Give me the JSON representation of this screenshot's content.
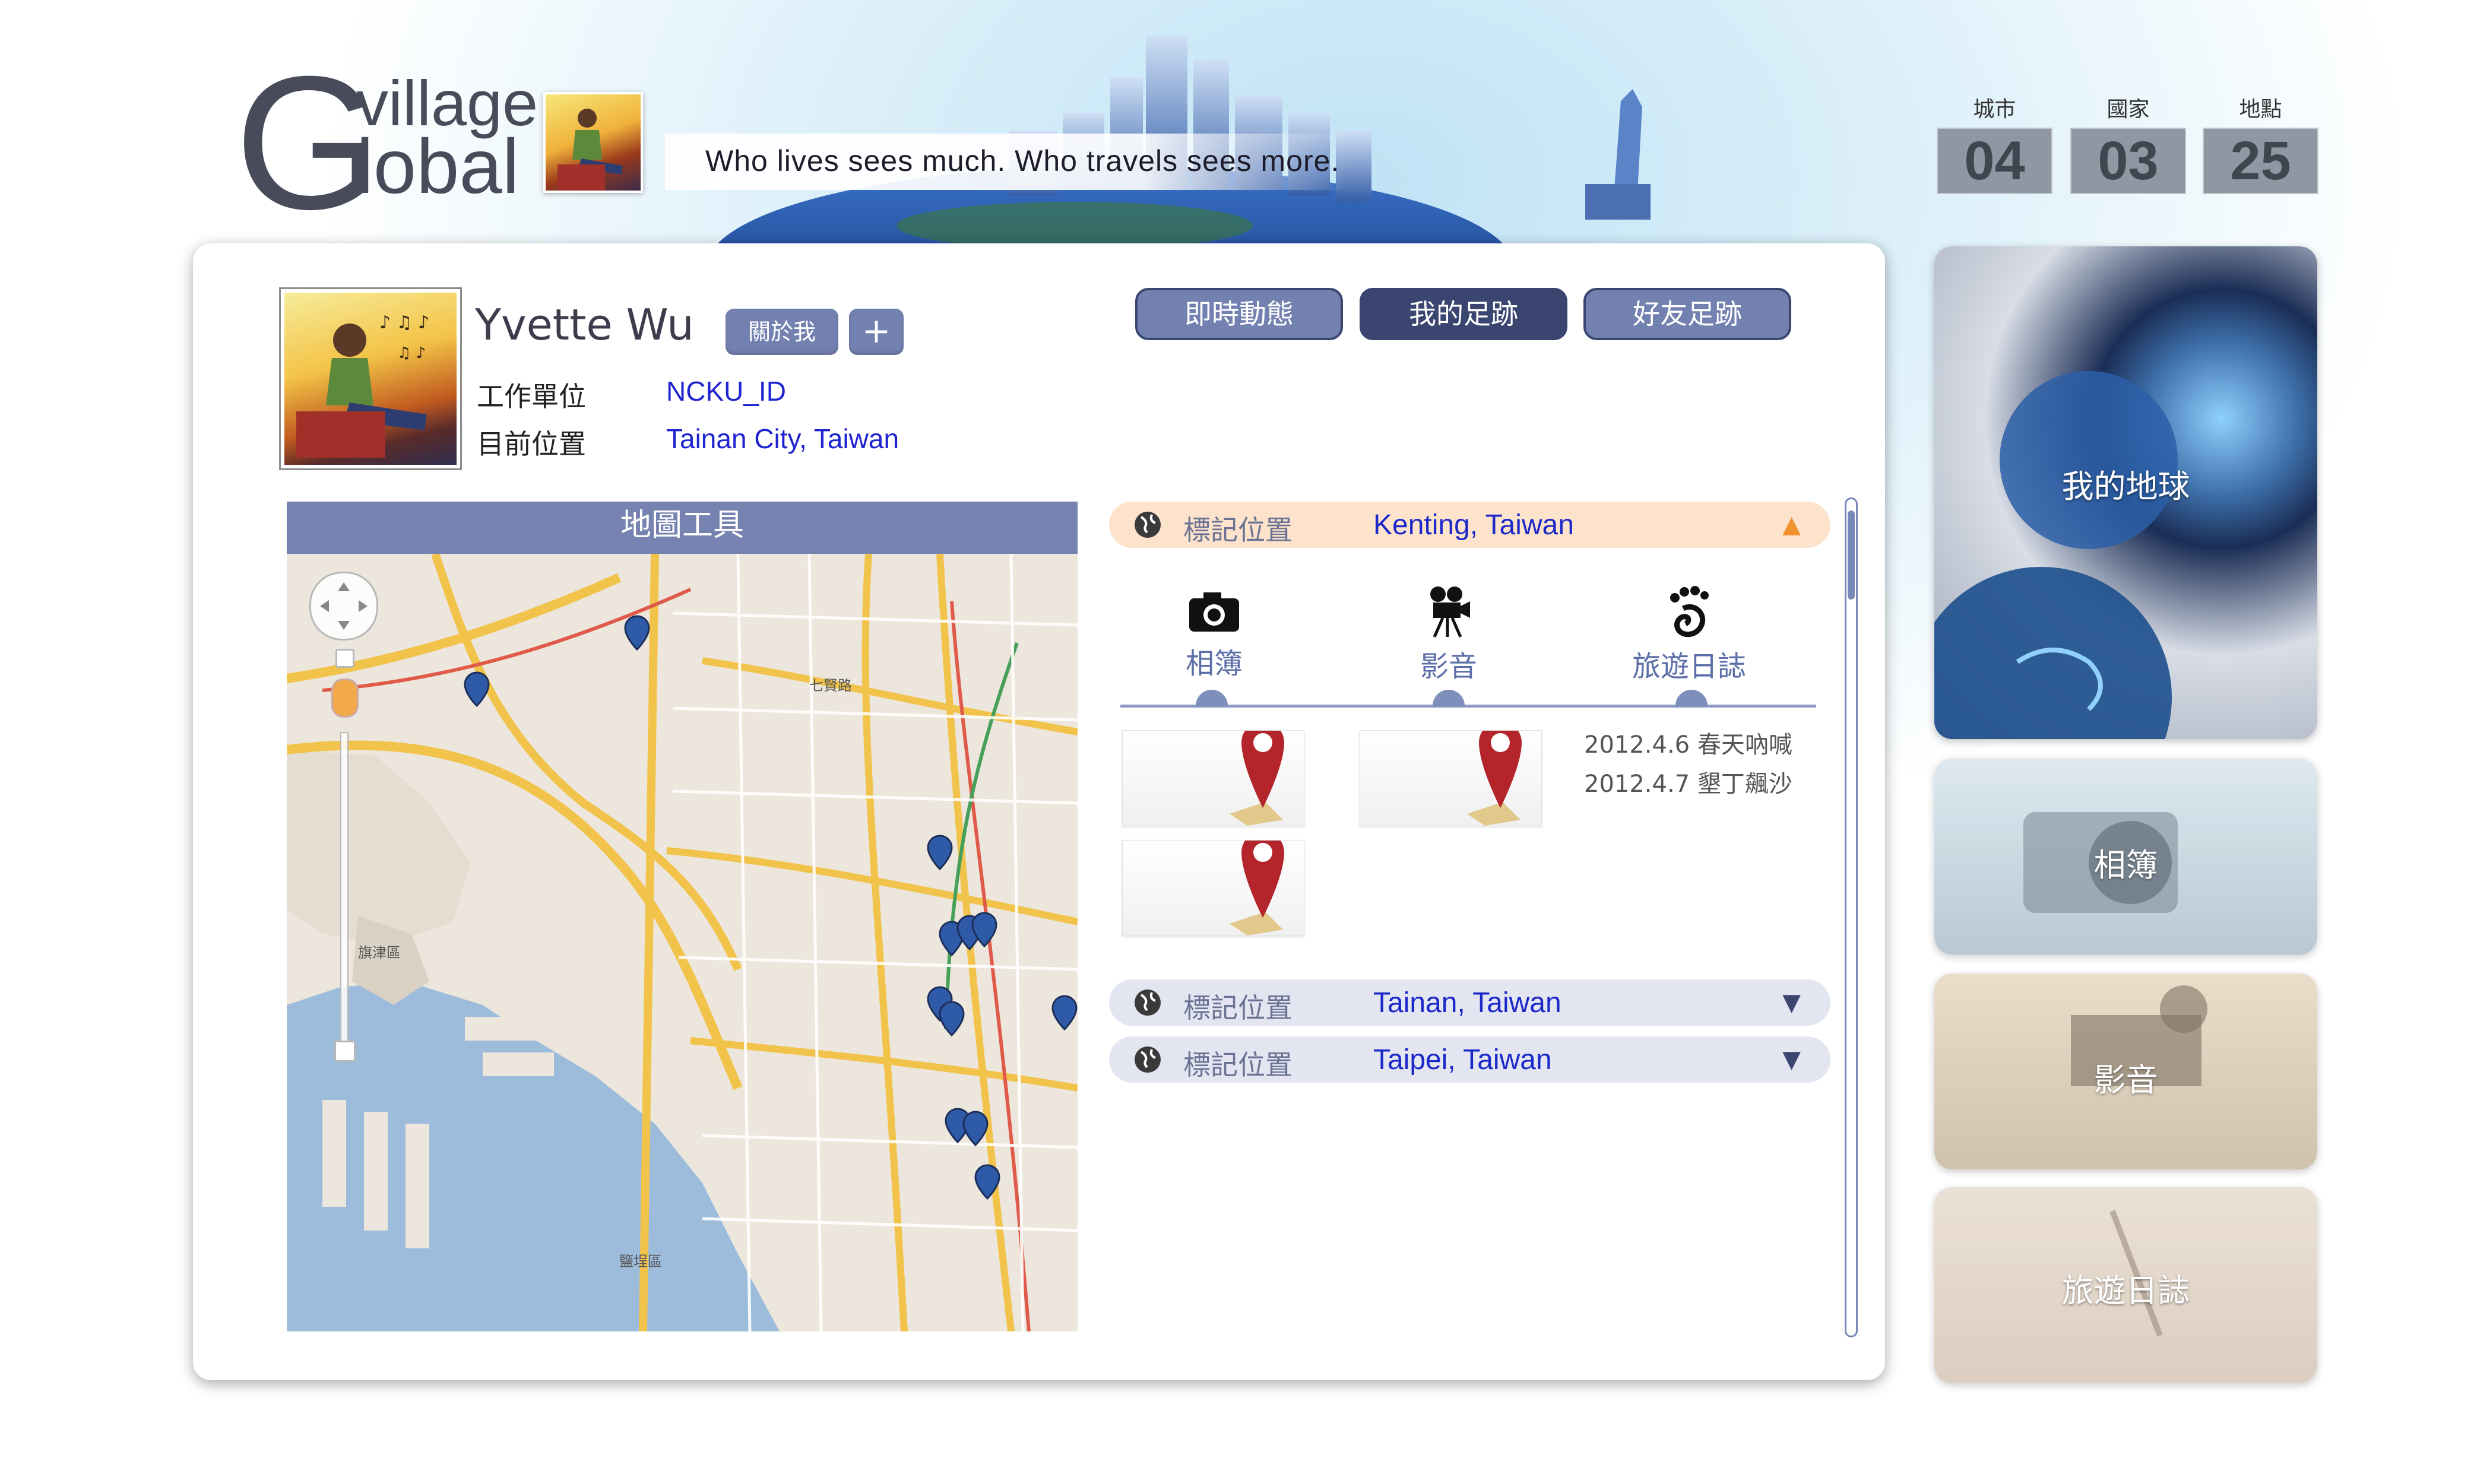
{
  "header": {
    "logo_big": "G",
    "logo_top": "village",
    "logo_bottom": "lobal",
    "tagline": "Who lives sees much. Who travels sees more.",
    "counters": [
      {
        "label": "城市",
        "value": "04"
      },
      {
        "label": "國家",
        "value": "03"
      },
      {
        "label": "地點",
        "value": "25"
      }
    ]
  },
  "profile": {
    "name": "Yvette Wu",
    "about_label": "關於我",
    "add_label": "+",
    "work_label": "工作單位",
    "work_value": "NCKU_ID",
    "location_label": "目前位置",
    "location_value": "Tainan City, Taiwan"
  },
  "nav": {
    "tabs": [
      {
        "label": "即時動態",
        "active": false
      },
      {
        "label": "我的足跡",
        "active": true
      },
      {
        "label": "好友足跡",
        "active": false
      }
    ]
  },
  "map": {
    "title": "地圖工具",
    "labels": {
      "district": "鹽埕區",
      "island": "旗津區",
      "road": "七賢路"
    }
  },
  "locations": {
    "items": [
      {
        "label": "標記位置",
        "value": "Kenting, Taiwan",
        "arrow": "▲",
        "expanded": true
      },
      {
        "label": "標記位置",
        "value": "Tainan, Taiwan",
        "arrow": "▼",
        "expanded": false
      },
      {
        "label": "標記位置",
        "value": "Taipei, Taiwan",
        "arrow": "▼",
        "expanded": false
      }
    ],
    "media": [
      {
        "label": "相簿",
        "icon": "camera-icon"
      },
      {
        "label": "影音",
        "icon": "video-camera-icon"
      },
      {
        "label": "旅遊日誌",
        "icon": "footprint-icon"
      }
    ],
    "diary_entries": [
      "2012.4.6 春天吶喊",
      "2012.4.7 墾丁飆沙"
    ]
  },
  "side_tiles": [
    {
      "label": "我的地球"
    },
    {
      "label": "相簿"
    },
    {
      "label": "影音"
    },
    {
      "label": "旅遊日誌"
    }
  ],
  "colors": {
    "accent": "#7381b0",
    "nav_active": "#3a4670",
    "link_blue": "#1c28c8",
    "expanded_bar": "#fde3cc",
    "collapsed_bar": "#e3e6f1",
    "pin_red": "#b3242b",
    "map_pin": "#2f5aa8"
  }
}
